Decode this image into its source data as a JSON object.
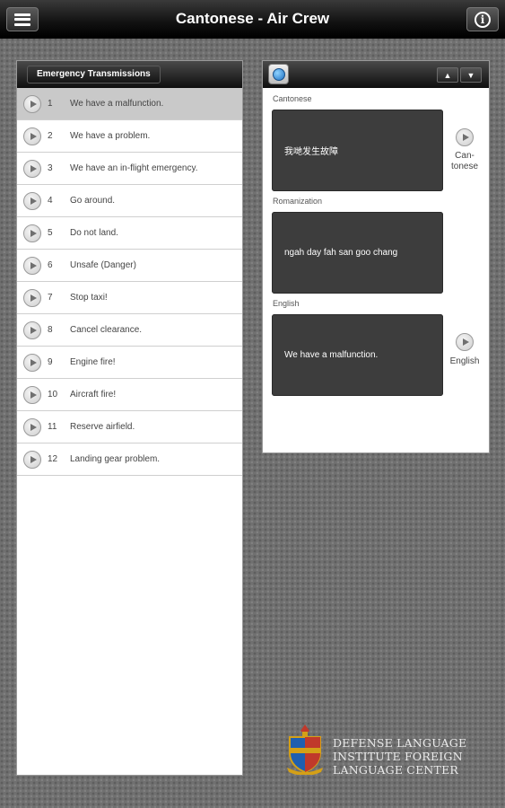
{
  "app": {
    "title": "Cantonese - Air Crew",
    "menu_icon": "menu-icon",
    "info_icon": "info-icon"
  },
  "list": {
    "header": "Emergency Transmissions",
    "items": [
      {
        "num": "1",
        "text": "We have a malfunction.",
        "selected": true
      },
      {
        "num": "2",
        "text": "We have a problem."
      },
      {
        "num": "3",
        "text": "We have an in-flight emergency."
      },
      {
        "num": "4",
        "text": "Go around."
      },
      {
        "num": "5",
        "text": "Do not land."
      },
      {
        "num": "6",
        "text": "Unsafe (Danger)"
      },
      {
        "num": "7",
        "text": "Stop taxi!"
      },
      {
        "num": "8",
        "text": "Cancel clearance."
      },
      {
        "num": "9",
        "text": "Engine fire!"
      },
      {
        "num": "10",
        "text": "Aircraft fire!"
      },
      {
        "num": "11",
        "text": "Reserve airfield."
      },
      {
        "num": "12",
        "text": "Landing gear problem."
      }
    ]
  },
  "detail": {
    "globe_icon": "globe-icon",
    "up_arrow": "▲",
    "down_arrow": "▼",
    "cantonese_label": "Cantonese",
    "cantonese_text": "我哋发生故障",
    "cantonese_play_label": "Can-\ntonese",
    "romanization_label": "Romanization",
    "romanization_text": "ngah day fah san goo chang",
    "english_label": "English",
    "english_text": "We have a malfunction.",
    "english_play_label": "English"
  },
  "logo": {
    "line1": "DEFENSE LANGUAGE",
    "line2": "INSTITUTE FOREIGN",
    "line3": "LANGUAGE CENTER"
  },
  "colors": {
    "background": "#707070",
    "selected_row": "#c9c9c9",
    "text_box": "#3d3d3d"
  }
}
